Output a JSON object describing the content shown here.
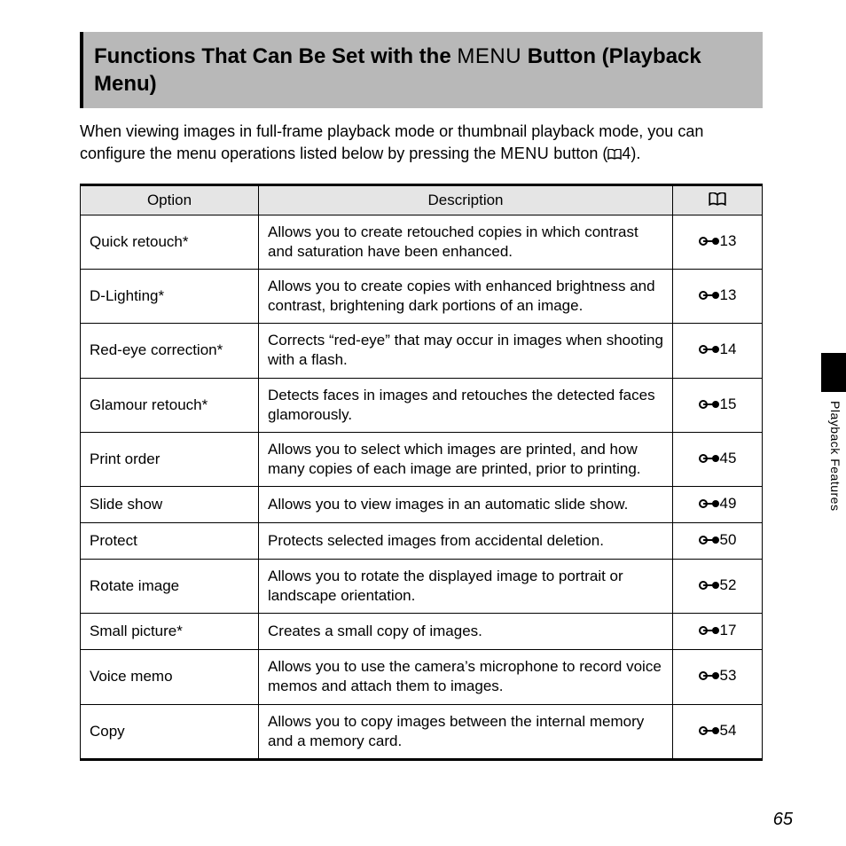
{
  "title_pre": "Functions That Can Be Set with the ",
  "title_menu": "MENU",
  "title_post": " Button (Playback Menu)",
  "intro_pre": "When viewing images in full-frame playback mode or thumbnail playback mode, you can configure the menu operations listed below by pressing the ",
  "intro_menu": "MENU",
  "intro_post1": " button (",
  "intro_ref": "4",
  "intro_post2": ").",
  "headers": {
    "option": "Option",
    "description": "Description"
  },
  "rows": [
    {
      "option": "Quick retouch*",
      "desc": "Allows you to create retouched copies in which contrast and saturation have been enhanced.",
      "ref": "13"
    },
    {
      "option": "D-Lighting*",
      "desc": "Allows you to create copies with enhanced brightness and contrast, brightening dark portions of an image.",
      "ref": "13"
    },
    {
      "option": "Red-eye correction*",
      "desc": "Corrects “red-eye” that may occur in images when shooting with a flash.",
      "ref": "14"
    },
    {
      "option": "Glamour retouch*",
      "desc": "Detects faces in images and retouches the detected faces glamorously.",
      "ref": "15"
    },
    {
      "option": "Print order",
      "desc": "Allows you to select which images are printed, and how many copies of each image are printed, prior to printing.",
      "ref": "45"
    },
    {
      "option": "Slide show",
      "desc": "Allows you to view images in an automatic slide show.",
      "ref": "49"
    },
    {
      "option": "Protect",
      "desc": "Protects selected images from accidental deletion.",
      "ref": "50"
    },
    {
      "option": "Rotate image",
      "desc": "Allows you to rotate the displayed image to portrait or landscape orientation.",
      "ref": "52"
    },
    {
      "option": "Small picture*",
      "desc": "Creates a small copy of images.",
      "ref": "17"
    },
    {
      "option": "Voice memo",
      "desc": "Allows you to use the camera’s microphone to record voice memos and attach them to images.",
      "ref": "53"
    },
    {
      "option": "Copy",
      "desc": "Allows you to copy images between the internal memory and a memory card.",
      "ref": "54"
    }
  ],
  "side_label": "Playback Features",
  "page_number": "65"
}
